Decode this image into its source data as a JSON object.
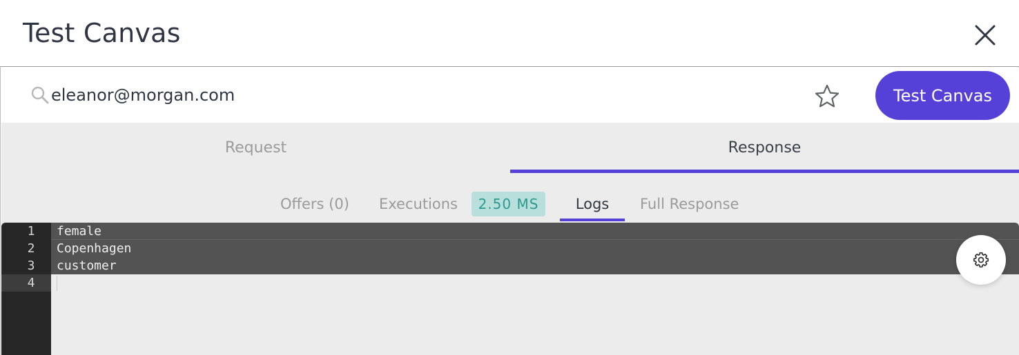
{
  "dialog": {
    "title": "Test Canvas"
  },
  "search": {
    "value": "eleanor@morgan.com"
  },
  "actions": {
    "test_button_label": "Test Canvas"
  },
  "tabs": {
    "request": "Request",
    "response": "Response",
    "active": "Response"
  },
  "subtabs": {
    "offers": "Offers (0)",
    "executions": "Executions",
    "execution_time": "2.50 MS",
    "logs": "Logs",
    "full_response": "Full Response",
    "active": "Logs"
  },
  "editor": {
    "line_numbers": [
      "1",
      "2",
      "3",
      "4"
    ],
    "lines": [
      "female",
      "Copenhagen",
      "customer",
      ""
    ]
  },
  "icons": {
    "close": "close-icon",
    "search": "search-icon",
    "star": "star-icon",
    "settings": "gear-icon"
  },
  "colors": {
    "accent": "#5540d8",
    "badge_bg": "#b8dfdb",
    "badge_text": "#2a9a8f"
  }
}
